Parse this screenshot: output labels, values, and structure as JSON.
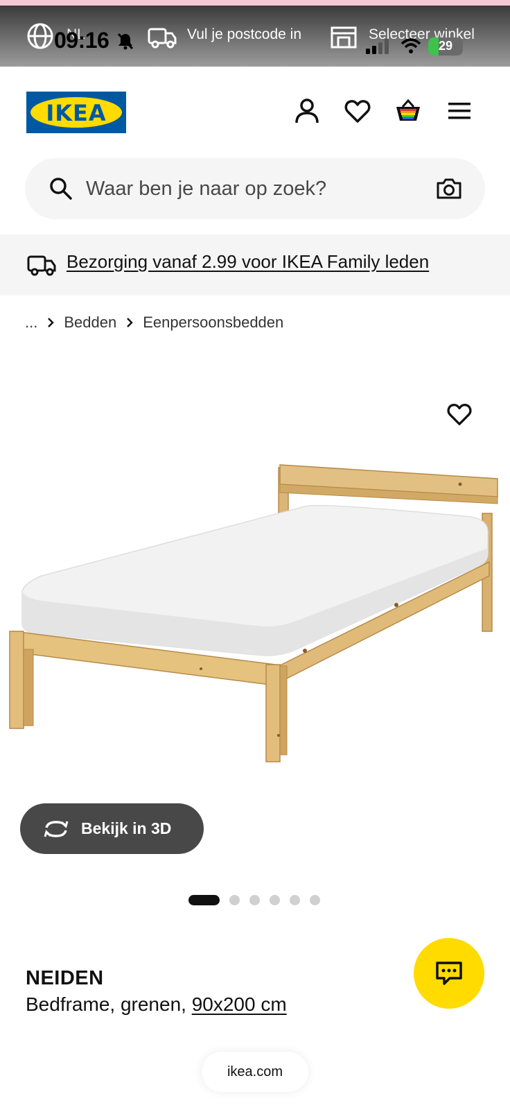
{
  "status_bar": {
    "language": "NL",
    "time": "09:16",
    "postcode_prompt": "Vul je postcode in",
    "store_prompt": "Selecteer winkel",
    "battery_level": "29",
    "battery_fraction": 0.29
  },
  "header": {
    "logo_text": "IKEA",
    "icons": [
      "user-icon",
      "heart-icon",
      "shopping-bag-icon",
      "menu-icon"
    ]
  },
  "search": {
    "placeholder": "Waar ben je naar op zoek?"
  },
  "promo": {
    "text": "Bezorging vanaf 2.99 voor IKEA Family leden"
  },
  "breadcrumb": {
    "items": [
      "...",
      "Bedden",
      "Eenpersoonsbedden"
    ]
  },
  "gallery": {
    "view_3d_label": "Bekijk in 3D",
    "image_count": 6,
    "active_index": 0
  },
  "product": {
    "name": "NEIDEN",
    "description": "Bedframe, grenen, ",
    "size": "90x200 cm"
  },
  "browser": {
    "url": "ikea.com"
  },
  "colors": {
    "ikea_blue": "#0058a3",
    "ikea_yellow": "#ffdb00",
    "button_dark": "#484848"
  }
}
